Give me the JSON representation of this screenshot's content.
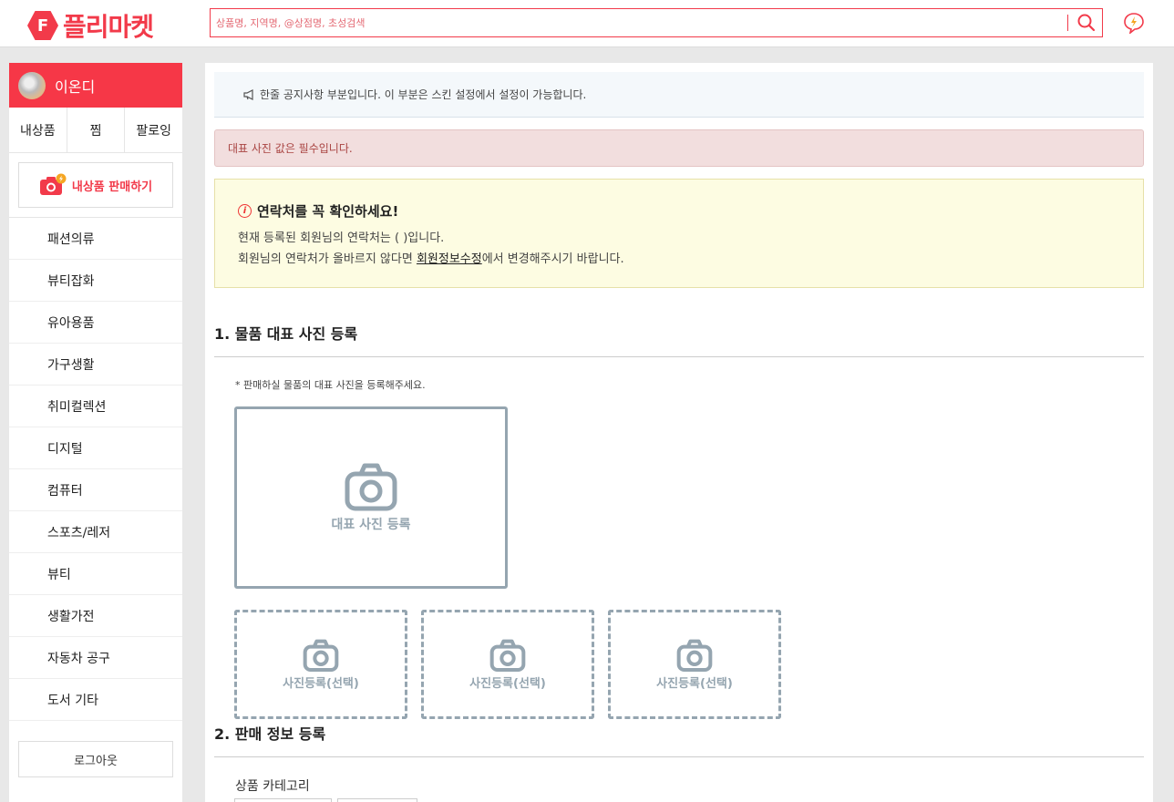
{
  "header": {
    "logo_mark": "F",
    "logo_text": "플리마켓",
    "search_placeholder": "상품명, 지역명, @상점명, 초성검색",
    "search_icon": "search-icon",
    "notify_icon": "lightning-chat-icon"
  },
  "sidebar": {
    "user_name": "이온디",
    "tabs": [
      "내상품",
      "찜",
      "팔로잉"
    ],
    "sell_button": "내상품 판매하기",
    "categories": [
      "패션의류",
      "뷰티잡화",
      "유아용품",
      "가구생활",
      "취미컬렉션",
      "디지털",
      "컴퓨터",
      "스포츠/레저",
      "뷰티",
      "생활가전",
      "자동차 공구",
      "도서 기타"
    ],
    "logout": "로그아웃"
  },
  "main": {
    "notice": "한줄 공지사항 부분입니다. 이 부분은 스킨 설정에서 설정이 가능합니다.",
    "error": "대표 사진 값은 필수입니다.",
    "warning": {
      "title": "연락처를 꼭 확인하세요!",
      "line1": "현재 등록된 회원님의 연락처는 ( )입니다.",
      "line2_prefix": "회원님의 연락처가 올바르지 않다면 ",
      "line2_link": "회원정보수정",
      "line2_suffix": "에서 변경해주시기 바랍니다."
    },
    "section1_title": "1. 물품 대표 사진 등록",
    "photo_hint": "* 판매하실 물품의 대표 사진을 등록해주세요.",
    "main_photo_label": "대표 사진 등록",
    "sub_photo_labels": [
      "사진등록(선택)",
      "사진등록(선택)",
      "사진등록(선택)"
    ],
    "section2_title": "2. 판매 정보 등록",
    "category_label": "상품 카테고리"
  },
  "colors": {
    "brand": "#f23a4a",
    "photo_border": "#95a5b0",
    "error_bg": "#f2dede",
    "warning_bg": "#fdfce2"
  }
}
